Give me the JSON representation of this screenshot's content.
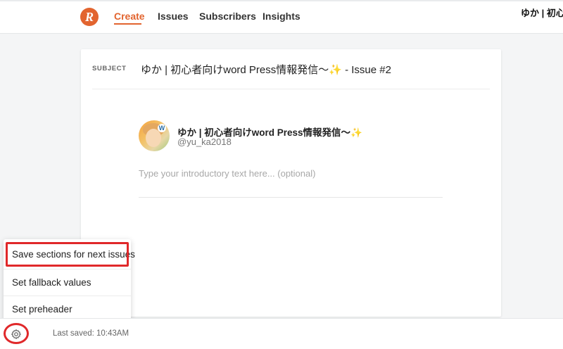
{
  "nav": {
    "logo_letter": "R",
    "items": [
      {
        "label": "Create",
        "active": true
      },
      {
        "label": "Issues",
        "active": false
      },
      {
        "label": "Subscribers",
        "active": false
      },
      {
        "label": "Insights",
        "active": false
      }
    ],
    "account_name": "ゆか | 初心者"
  },
  "editor": {
    "subject_label": "SUBJECT",
    "subject_text": "ゆか | 初心者向けword Press情報発信〜✨ - Issue #2",
    "profile_name": "ゆか | 初心者向けword Press情報発信〜✨",
    "profile_handle": "@yu_ka2018",
    "intro_placeholder": "Type your introductory text here... (optional)",
    "intro_value": ""
  },
  "menu": {
    "items": [
      {
        "label": "Save sections for next issues",
        "highlighted": true
      },
      {
        "label": "Set fallback values",
        "highlighted": false
      },
      {
        "label": "Set preheader",
        "highlighted": false
      }
    ]
  },
  "footer": {
    "last_saved": "Last saved: 10:43AM"
  },
  "colors": {
    "accent": "#e2642f",
    "highlight": "#e0282a"
  },
  "icons": {
    "settings": "gear-icon"
  }
}
